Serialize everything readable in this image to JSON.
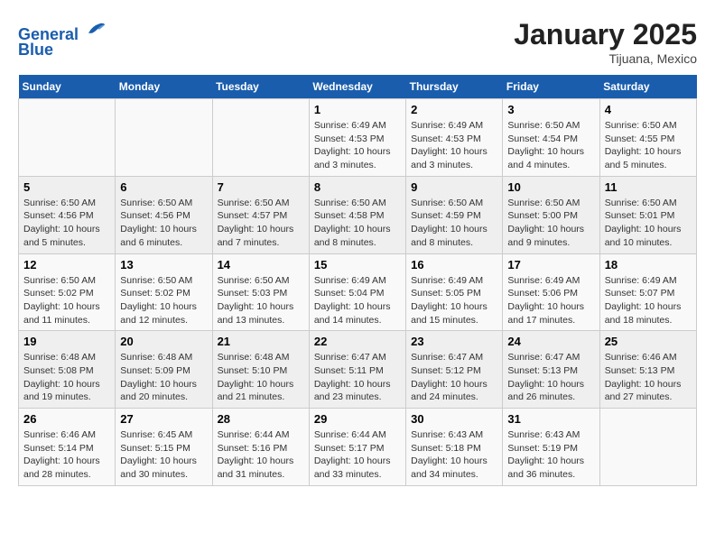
{
  "header": {
    "logo_line1": "General",
    "logo_line2": "Blue",
    "month_title": "January 2025",
    "subtitle": "Tijuana, Mexico"
  },
  "days_of_week": [
    "Sunday",
    "Monday",
    "Tuesday",
    "Wednesday",
    "Thursday",
    "Friday",
    "Saturday"
  ],
  "weeks": [
    [
      {
        "num": "",
        "info": ""
      },
      {
        "num": "",
        "info": ""
      },
      {
        "num": "",
        "info": ""
      },
      {
        "num": "1",
        "info": "Sunrise: 6:49 AM\nSunset: 4:53 PM\nDaylight: 10 hours\nand 3 minutes."
      },
      {
        "num": "2",
        "info": "Sunrise: 6:49 AM\nSunset: 4:53 PM\nDaylight: 10 hours\nand 3 minutes."
      },
      {
        "num": "3",
        "info": "Sunrise: 6:50 AM\nSunset: 4:54 PM\nDaylight: 10 hours\nand 4 minutes."
      },
      {
        "num": "4",
        "info": "Sunrise: 6:50 AM\nSunset: 4:55 PM\nDaylight: 10 hours\nand 5 minutes."
      }
    ],
    [
      {
        "num": "5",
        "info": "Sunrise: 6:50 AM\nSunset: 4:56 PM\nDaylight: 10 hours\nand 5 minutes."
      },
      {
        "num": "6",
        "info": "Sunrise: 6:50 AM\nSunset: 4:56 PM\nDaylight: 10 hours\nand 6 minutes."
      },
      {
        "num": "7",
        "info": "Sunrise: 6:50 AM\nSunset: 4:57 PM\nDaylight: 10 hours\nand 7 minutes."
      },
      {
        "num": "8",
        "info": "Sunrise: 6:50 AM\nSunset: 4:58 PM\nDaylight: 10 hours\nand 8 minutes."
      },
      {
        "num": "9",
        "info": "Sunrise: 6:50 AM\nSunset: 4:59 PM\nDaylight: 10 hours\nand 8 minutes."
      },
      {
        "num": "10",
        "info": "Sunrise: 6:50 AM\nSunset: 5:00 PM\nDaylight: 10 hours\nand 9 minutes."
      },
      {
        "num": "11",
        "info": "Sunrise: 6:50 AM\nSunset: 5:01 PM\nDaylight: 10 hours\nand 10 minutes."
      }
    ],
    [
      {
        "num": "12",
        "info": "Sunrise: 6:50 AM\nSunset: 5:02 PM\nDaylight: 10 hours\nand 11 minutes."
      },
      {
        "num": "13",
        "info": "Sunrise: 6:50 AM\nSunset: 5:02 PM\nDaylight: 10 hours\nand 12 minutes."
      },
      {
        "num": "14",
        "info": "Sunrise: 6:50 AM\nSunset: 5:03 PM\nDaylight: 10 hours\nand 13 minutes."
      },
      {
        "num": "15",
        "info": "Sunrise: 6:49 AM\nSunset: 5:04 PM\nDaylight: 10 hours\nand 14 minutes."
      },
      {
        "num": "16",
        "info": "Sunrise: 6:49 AM\nSunset: 5:05 PM\nDaylight: 10 hours\nand 15 minutes."
      },
      {
        "num": "17",
        "info": "Sunrise: 6:49 AM\nSunset: 5:06 PM\nDaylight: 10 hours\nand 17 minutes."
      },
      {
        "num": "18",
        "info": "Sunrise: 6:49 AM\nSunset: 5:07 PM\nDaylight: 10 hours\nand 18 minutes."
      }
    ],
    [
      {
        "num": "19",
        "info": "Sunrise: 6:48 AM\nSunset: 5:08 PM\nDaylight: 10 hours\nand 19 minutes."
      },
      {
        "num": "20",
        "info": "Sunrise: 6:48 AM\nSunset: 5:09 PM\nDaylight: 10 hours\nand 20 minutes."
      },
      {
        "num": "21",
        "info": "Sunrise: 6:48 AM\nSunset: 5:10 PM\nDaylight: 10 hours\nand 21 minutes."
      },
      {
        "num": "22",
        "info": "Sunrise: 6:47 AM\nSunset: 5:11 PM\nDaylight: 10 hours\nand 23 minutes."
      },
      {
        "num": "23",
        "info": "Sunrise: 6:47 AM\nSunset: 5:12 PM\nDaylight: 10 hours\nand 24 minutes."
      },
      {
        "num": "24",
        "info": "Sunrise: 6:47 AM\nSunset: 5:13 PM\nDaylight: 10 hours\nand 26 minutes."
      },
      {
        "num": "25",
        "info": "Sunrise: 6:46 AM\nSunset: 5:13 PM\nDaylight: 10 hours\nand 27 minutes."
      }
    ],
    [
      {
        "num": "26",
        "info": "Sunrise: 6:46 AM\nSunset: 5:14 PM\nDaylight: 10 hours\nand 28 minutes."
      },
      {
        "num": "27",
        "info": "Sunrise: 6:45 AM\nSunset: 5:15 PM\nDaylight: 10 hours\nand 30 minutes."
      },
      {
        "num": "28",
        "info": "Sunrise: 6:44 AM\nSunset: 5:16 PM\nDaylight: 10 hours\nand 31 minutes."
      },
      {
        "num": "29",
        "info": "Sunrise: 6:44 AM\nSunset: 5:17 PM\nDaylight: 10 hours\nand 33 minutes."
      },
      {
        "num": "30",
        "info": "Sunrise: 6:43 AM\nSunset: 5:18 PM\nDaylight: 10 hours\nand 34 minutes."
      },
      {
        "num": "31",
        "info": "Sunrise: 6:43 AM\nSunset: 5:19 PM\nDaylight: 10 hours\nand 36 minutes."
      },
      {
        "num": "",
        "info": ""
      }
    ]
  ]
}
